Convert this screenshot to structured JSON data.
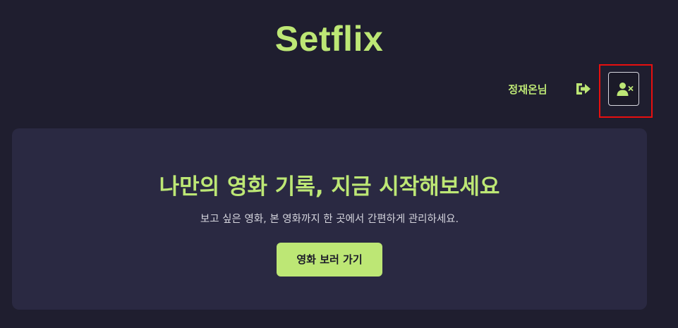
{
  "header": {
    "logo": "Setflix",
    "user_name": "정재온님",
    "logout_icon": "sign-out-icon",
    "withdraw_icon": "user-xmark-icon"
  },
  "hero": {
    "title": "나만의 영화 기록, 지금 시작해보세요",
    "subtitle": "보고 싶은 영화, 본 영화까지 한 곳에서 간편하게 관리하세요.",
    "cta_label": "영화 보러 가기"
  },
  "colors": {
    "background": "#1f1e2f",
    "card": "#2a2942",
    "accent": "#bde775",
    "highlight": "#e80f0f"
  }
}
